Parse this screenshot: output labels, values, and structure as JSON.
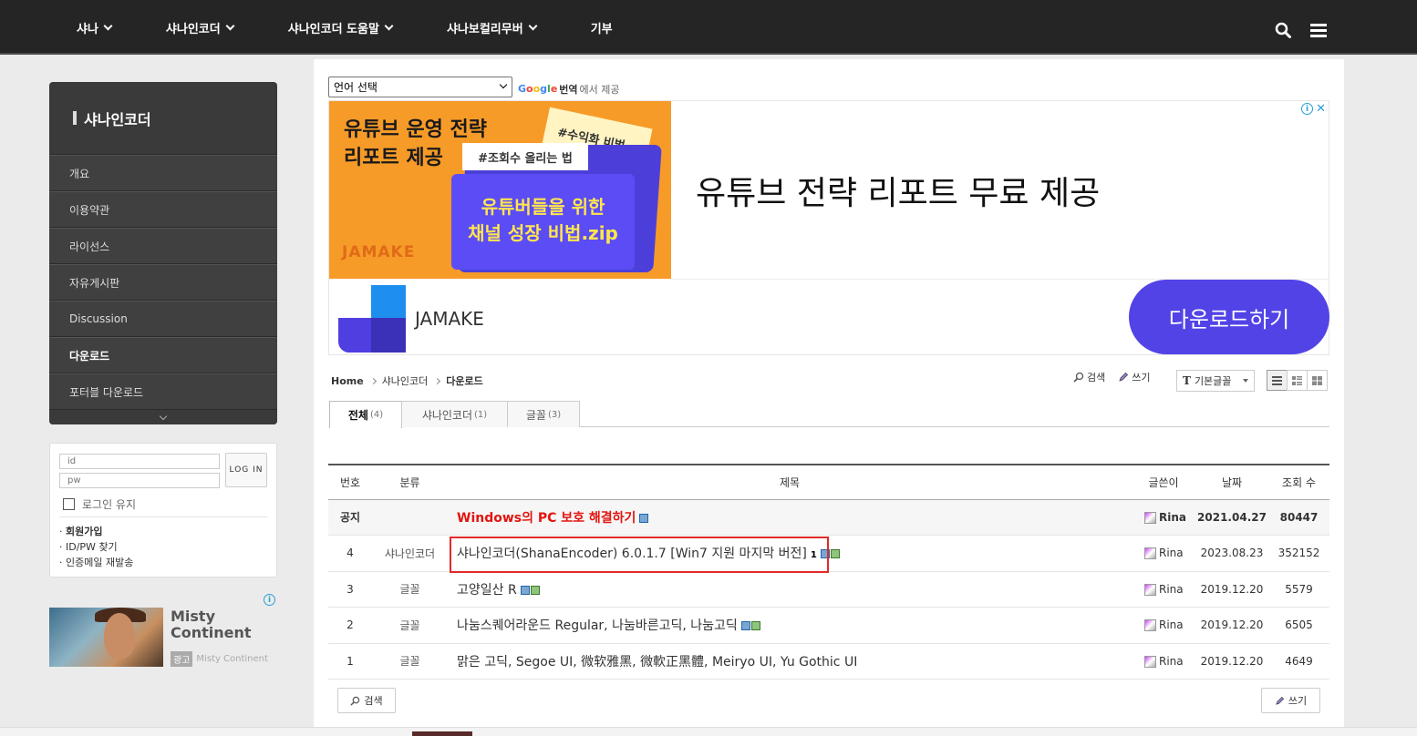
{
  "topnav": {
    "items": [
      {
        "label": "샤나",
        "has_dropdown": true
      },
      {
        "label": "샤나인코더",
        "has_dropdown": true
      },
      {
        "label": "샤나인코더 도움말",
        "has_dropdown": true
      },
      {
        "label": "샤나보컬리무버",
        "has_dropdown": true
      },
      {
        "label": "기부",
        "has_dropdown": false
      }
    ],
    "icons": [
      "search-icon",
      "menu-icon"
    ]
  },
  "sidebar": {
    "title": "샤나인코더",
    "items": [
      {
        "label": "개요"
      },
      {
        "label": "이용약관"
      },
      {
        "label": "라이선스"
      },
      {
        "label": "자유게시판"
      },
      {
        "label": "Discussion"
      },
      {
        "label": "다운로드",
        "active": true
      },
      {
        "label": "포터블 다운로드"
      }
    ]
  },
  "login": {
    "id_placeholder": "id",
    "pw_placeholder": "pw",
    "button": "LOG IN",
    "keep_label": "로그인 유지",
    "links": [
      "회원가입",
      "ID/PW 찾기",
      "인증메일 재발송"
    ]
  },
  "side_ad": {
    "name": "Misty Continent",
    "tag_label": "광고",
    "tag_text": "Misty Continent"
  },
  "translate": {
    "select_value": "언어 선택",
    "google": "Google",
    "powered_text_bold": "번역",
    "powered_text": "에서 제공"
  },
  "banner": {
    "art_heading_1": "유튜브 운영 전략",
    "art_heading_2": "리포트 제공",
    "note1": "#수익화 비법",
    "note2": "#조회수 올리는 법",
    "card_1": "유튜버들을 위한",
    "card_2": "채널 성장 비법.zip",
    "art_brand": "JAMAKE",
    "headline": "유튜브 전략 리포트 무료 제공",
    "brand_name": "JAMAKE",
    "cta": "다운로드하기"
  },
  "breadcrumb": [
    "Home",
    "샤나인코더",
    "다운로드"
  ],
  "toolbar": {
    "search": "검색",
    "write": "쓰기",
    "font_select": "기본글꼴"
  },
  "tabs": [
    {
      "label": "전체",
      "count": "(4)",
      "active": true
    },
    {
      "label": "샤나인코더",
      "count": "(1)"
    },
    {
      "label": "글꼴",
      "count": "(3)"
    }
  ],
  "table": {
    "headers": [
      "번호",
      "분류",
      "제목",
      "글쓴이",
      "날짜",
      "조회 수"
    ],
    "rows": [
      {
        "no": "공지",
        "cat": "",
        "title": "Windows의 PC 보호 해결하기",
        "comments": "",
        "author": "Rina",
        "date": "2021.04.27",
        "views": "80447",
        "notice": true
      },
      {
        "no": "4",
        "cat": "샤나인코더",
        "title": "샤나인코더(ShanaEncoder) 6.0.1.7 [Win7 지원 마지막 버전]",
        "comments": "1",
        "author": "Rina",
        "date": "2023.08.23",
        "views": "352152"
      },
      {
        "no": "3",
        "cat": "글꼴",
        "title": "고양일산 R",
        "comments": "",
        "author": "Rina",
        "date": "2019.12.20",
        "views": "5579"
      },
      {
        "no": "2",
        "cat": "글꼴",
        "title": "나눔스퀘어라운드 Regular, 나눔바른고딕, 나눔고딕",
        "comments": "",
        "author": "Rina",
        "date": "2019.12.20",
        "views": "6505"
      },
      {
        "no": "1",
        "cat": "글꼴",
        "title": "맑은 고딕, Segoe UI, 微软雅黑, 微軟正黑體, Meiryo UI, Yu Gothic UI",
        "comments": "",
        "author": "Rina",
        "date": "2019.12.20",
        "views": "4649"
      }
    ]
  },
  "bottom": {
    "search": "검색",
    "write": "쓰기"
  },
  "colors": {
    "topbar": "#252525",
    "notice_title": "#e3140f",
    "highlight_box": "#e02a2a",
    "cta": "#5243e6"
  }
}
